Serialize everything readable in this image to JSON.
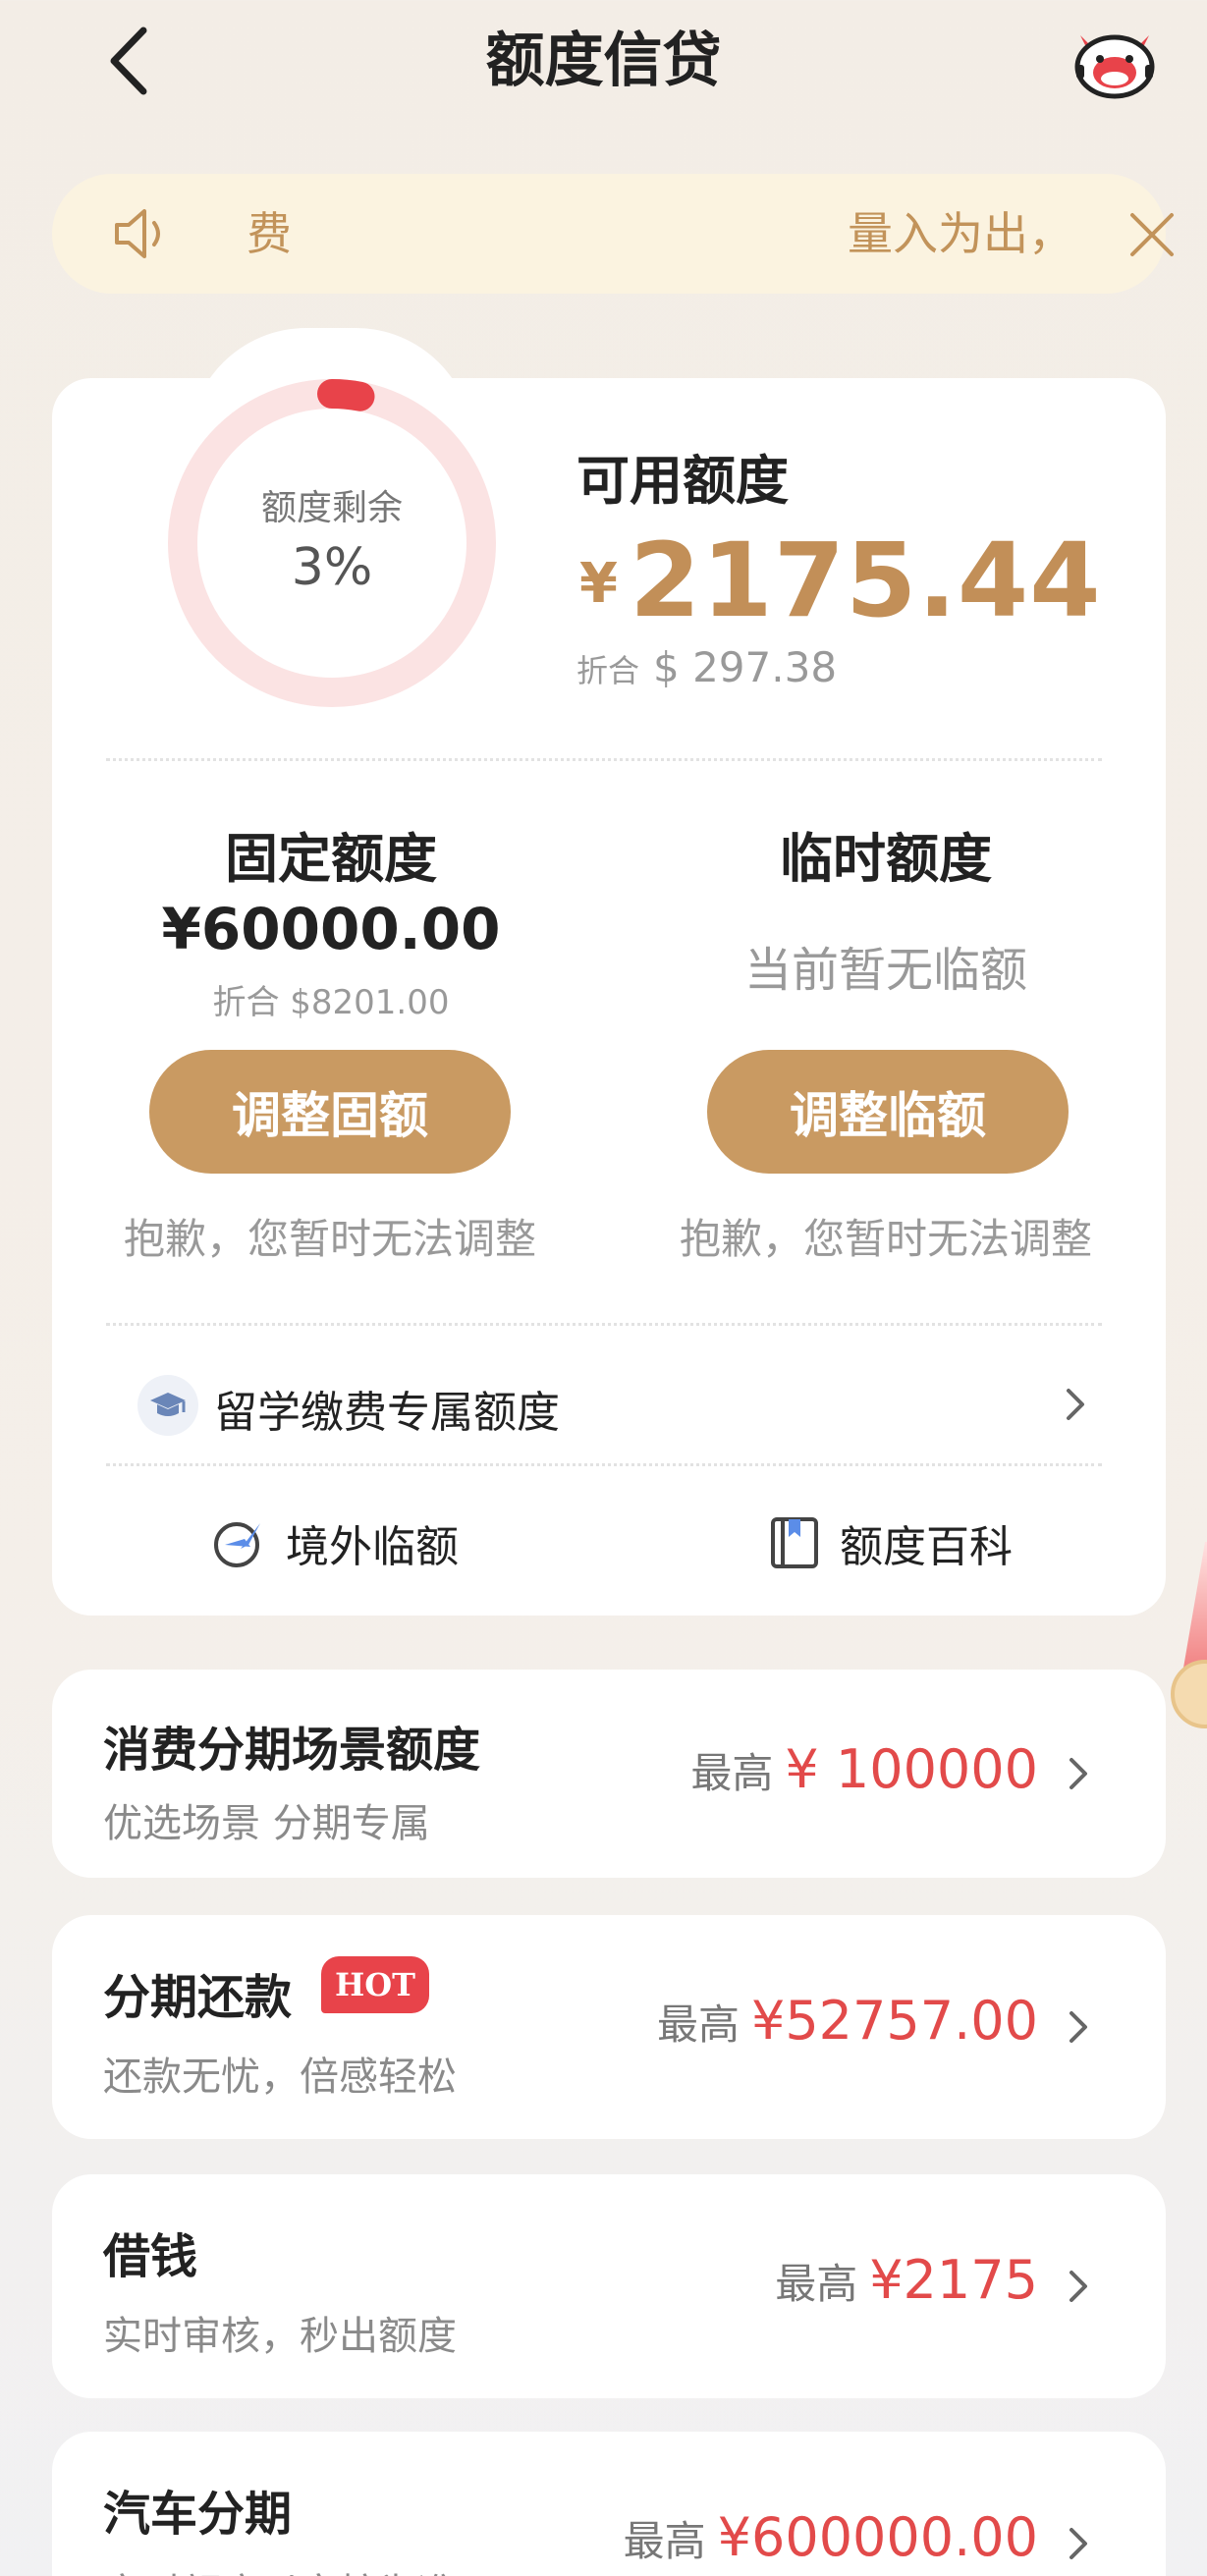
{
  "header": {
    "title": "额度信贷"
  },
  "notice": {
    "left_text": "费",
    "right_text": "量入为出，"
  },
  "credit": {
    "ring_label": "额度剩余",
    "ring_value": "3%",
    "remaining_fraction": 0.03,
    "available_label": "可用额度",
    "currency_symbol": "¥",
    "available_amount": "2175.44",
    "conv_label": "折合",
    "available_converted": "$ 297.38"
  },
  "fixed": {
    "title": "固定额度",
    "amount": "¥60000.00",
    "converted": "折合 $8201.00",
    "button_label": "调整固额",
    "note": "抱歉，您暂时无法调整"
  },
  "temporary": {
    "title": "临时额度",
    "status": "当前暂无临额",
    "button_label": "调整临额",
    "note": "抱歉，您暂时无法调整"
  },
  "study": {
    "label": "留学缴费专属额度"
  },
  "links": {
    "overseas": "境外临额",
    "wiki": "额度百科"
  },
  "products": [
    {
      "title": "消费分期场景额度",
      "subtitle": "优选场景 分期专属",
      "max_label": "最高",
      "max_value": "¥ 100000"
    },
    {
      "title": "分期还款",
      "badge": "HOT",
      "subtitle": "还款无忧，倍感轻松",
      "max_label": "最高",
      "max_value": "¥52757.00"
    },
    {
      "title": "借钱",
      "subtitle": "实时审核，秒出额度",
      "max_label": "最高",
      "max_value": "¥2175"
    },
    {
      "title": "汽车分期",
      "subtitle": "实时额度以审核为准",
      "max_label": "最高",
      "max_value": "¥600000.00"
    }
  ],
  "colors": {
    "accent_gold": "#c99a62",
    "amount_gold": "#c28f58",
    "price_red": "#e24a4a",
    "ring_track": "#fbe3e3",
    "ring_fill": "#e8434a",
    "notice_bg": "#fbf3e0"
  }
}
